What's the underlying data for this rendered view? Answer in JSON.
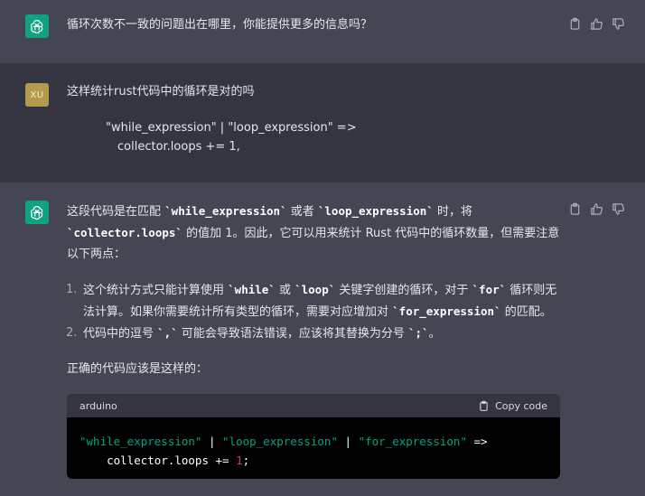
{
  "messages": {
    "first": {
      "text": "循环次数不一致的问题出在哪里，你能提供更多的信息吗？"
    },
    "user": {
      "avatar": "XU",
      "line1": "这样统计rust代码中的循环是对的吗",
      "code_line1": "\"while_expression\" | \"loop_expression\"  =>",
      "code_line2": "collector.loops += 1,"
    },
    "answer": {
      "p1_a": "这段代码是在匹配 ",
      "p1_code1": "`while_expression`",
      "p1_b": " 或者 ",
      "p1_code2": "`loop_expression`",
      "p1_c": " 时，将",
      "p1_code3": "`collector.loops`",
      "p1_d": " 的值加 1。因此，它可以用来统计 Rust 代码中的循环数量，但需要注意以下两点：",
      "li1_num": "1.",
      "li1_a": "这个统计方式只能计算使用 ",
      "li1_code1": "`while`",
      "li1_b": " 或 ",
      "li1_code2": "`loop`",
      "li1_c": " 关键字创建的循环，对于 ",
      "li1_code3": "`for`",
      "li1_d": " 循环则无法计算。如果你需要统计所有类型的循环，需要对应增加对 ",
      "li1_code4": "`for_expression`",
      "li1_e": " 的匹配。",
      "li2_num": "2.",
      "li2_a": "代码中的逗号 ",
      "li2_code1": "`,`",
      "li2_b": " 可能会导致语法错误，应该将其替换为分号 ",
      "li2_code2": "`;`",
      "li2_c": "。",
      "p2": "正确的代码应该是这样的：",
      "codeblock": {
        "lang": "arduino",
        "copy_label": "Copy code",
        "s1": "\"while_expression\"",
        "pipe1": " | ",
        "s2": "\"loop_expression\"",
        "pipe2": " | ",
        "s3": "\"for_expression\"",
        "arrow": " =>",
        "line2_a": "    collector.loops += ",
        "line2_num": "1",
        "line2_b": ";"
      }
    }
  },
  "colors": {
    "assistant_bg": "#444654",
    "user_bg": "#343541",
    "accent_green": "#10a37f",
    "code_string": "#00a67d",
    "code_number": "#df3079"
  },
  "icons": [
    "openai-logo-icon",
    "clipboard-icon",
    "thumbs-up-icon",
    "thumbs-down-icon"
  ]
}
